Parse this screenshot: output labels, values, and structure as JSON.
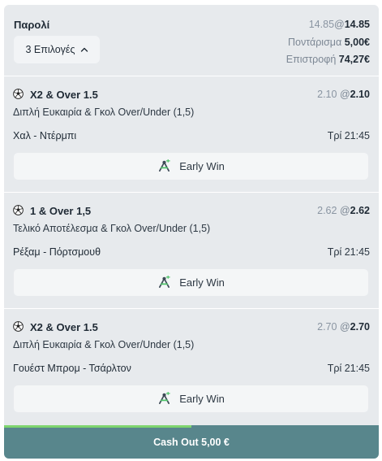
{
  "header": {
    "title": "Παρολί",
    "selections_button": "3 Επιλογές",
    "odds_original": "14.85",
    "odds_at": "@",
    "odds_current": "14.85",
    "stake_label": "Ποντάρισμα",
    "stake_value": "5,00€",
    "return_label": "Επιστροφή",
    "return_value": "74,27€"
  },
  "selections": [
    {
      "market": "X2 & Over 1.5",
      "odds_original": "2.10",
      "odds_at": "@",
      "odds_current": "2.10",
      "description": "Διπλή Ευκαιρία & Γκολ Over/Under (1,5)",
      "teams": "Χαλ - Ντέρμπι",
      "time": "Τρί 21:45",
      "early_win": "Early Win"
    },
    {
      "market": "1 & Over 1,5",
      "odds_original": "2.62",
      "odds_at": "@",
      "odds_current": "2.62",
      "description": "Τελικό Αποτέλεσμα & Γκολ Over/Under (1,5)",
      "teams": "Ρέξαμ - Πόρτσμουθ",
      "time": "Τρί 21:45",
      "early_win": "Early Win"
    },
    {
      "market": "X2 & Over 1.5",
      "odds_original": "2.70",
      "odds_at": "@",
      "odds_current": "2.70",
      "description": "Διπλή Ευκαιρία & Γκολ Over/Under (1,5)",
      "teams": "Γουέστ Μπρομ - Τσάρλτον",
      "time": "Τρί 21:45",
      "early_win": "Early Win"
    }
  ],
  "cashout": {
    "label": "Cash Out 5,00 €",
    "progress_fraction": 0.5,
    "color": "#58868c",
    "progress_color": "#7ed56f"
  },
  "icons": {
    "ball": "soccer-ball-icon",
    "chevron": "chevron-up-icon",
    "early_win": "early-win-icon"
  }
}
